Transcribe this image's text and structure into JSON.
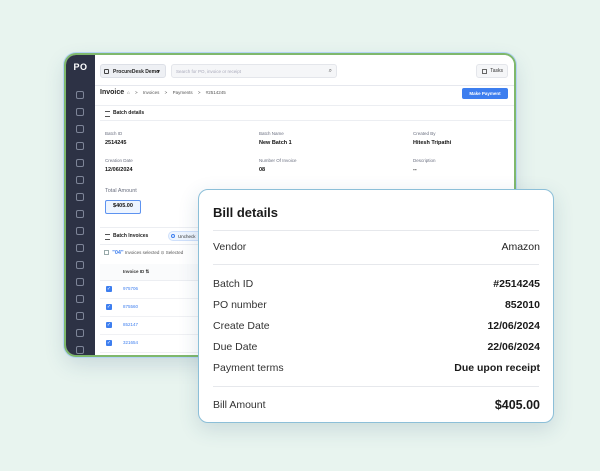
{
  "app": {
    "logo": "PO",
    "workspace": "ProcureDesk Demo",
    "search_placeholder": "Search for PO, invoice or receipt",
    "tasks_label": "Tasks",
    "page_title": "Invoice",
    "breadcrumbs": [
      "Invoices",
      "Payments",
      "#2514245"
    ],
    "make_payment": "Make Payment",
    "batch_details_title": "Batch details",
    "fields": {
      "batch_id_label": "Batch ID",
      "batch_id": "2514245",
      "batch_name_label": "Batch Name",
      "batch_name": "New Batch 1",
      "created_by_label": "Created By",
      "created_by": "Hitesh Tripathi",
      "creation_date_label": "Creation Date",
      "creation_date": "12/06/2024",
      "num_invoice_label": "Number Of Invoice",
      "num_invoice": "08",
      "description_label": "Description",
      "description": "--",
      "total_amount_label": "Total Amount",
      "total_amount": "$405.00"
    },
    "tabs": {
      "batch_invoices": "Batch Invoices",
      "uncheck": "Uncheck"
    },
    "selection": {
      "count": "\"04\"",
      "text": "Invoices selected",
      "selected_label": "Selected"
    },
    "table": {
      "col_invoice_id": "Invoice ID",
      "rows": [
        "975706",
        "875560",
        "852147",
        "321654"
      ]
    }
  },
  "bill_details": {
    "title": "Bill details",
    "vendor_label": "Vendor",
    "vendor": "Amazon",
    "batch_id_label": "Batch ID",
    "batch_id": "#2514245",
    "po_label": "PO number",
    "po": "852010",
    "create_date_label": "Create Date",
    "create_date": "12/06/2024",
    "due_date_label": "Due Date",
    "due_date": "22/06/2024",
    "terms_label": "Payment terms",
    "terms": "Due upon receipt",
    "bill_amount_label": "Bill Amount",
    "bill_amount": "$405.00"
  },
  "colors": {
    "accent": "#3d7eef",
    "sidebar": "#2d3245",
    "background": "#e8f4ef"
  }
}
